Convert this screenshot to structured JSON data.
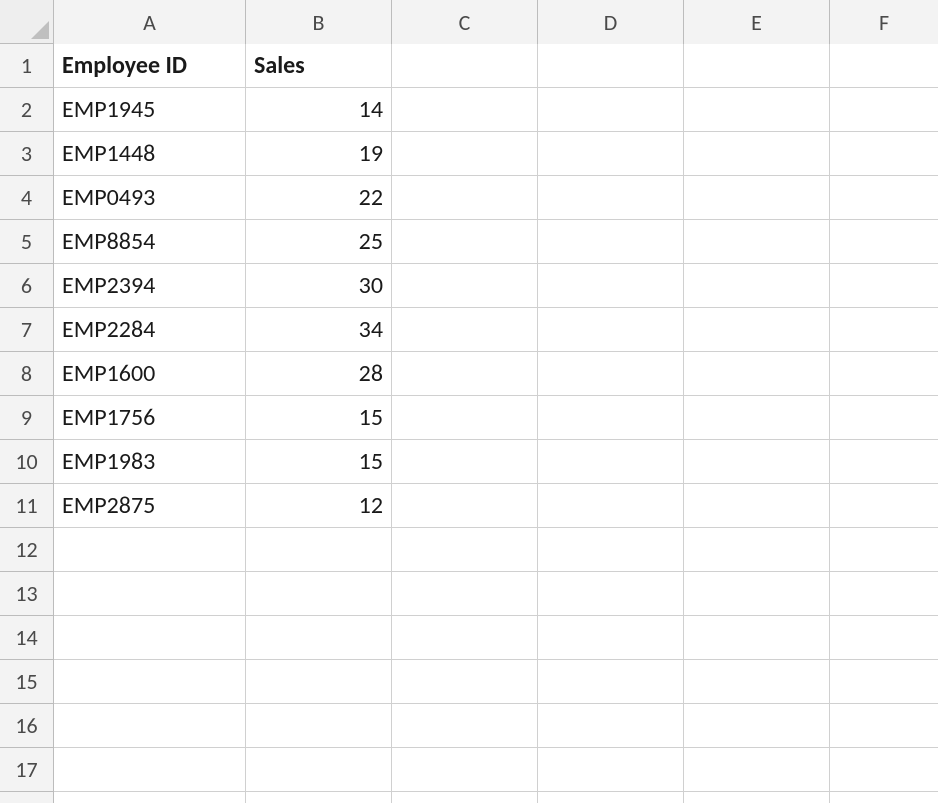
{
  "chart_data": {
    "type": "table",
    "columns": [
      "Employee ID",
      "Sales"
    ],
    "rows": [
      [
        "EMP1945",
        14
      ],
      [
        "EMP1448",
        19
      ],
      [
        "EMP0493",
        22
      ],
      [
        "EMP8854",
        25
      ],
      [
        "EMP2394",
        30
      ],
      [
        "EMP2284",
        34
      ],
      [
        "EMP1600",
        28
      ],
      [
        "EMP1756",
        15
      ],
      [
        "EMP1983",
        15
      ],
      [
        "EMP2875",
        12
      ]
    ]
  },
  "columns": {
    "labels": [
      "A",
      "B",
      "C",
      "D",
      "E",
      "F"
    ],
    "widths": [
      192,
      146,
      146,
      146,
      146,
      108
    ]
  },
  "rows": {
    "count": 18
  },
  "headers": {
    "A1": "Employee ID",
    "B1": "Sales"
  },
  "data": {
    "A2": "EMP1945",
    "B2": "14",
    "A3": "EMP1448",
    "B3": "19",
    "A4": "EMP0493",
    "B4": "22",
    "A5": "EMP8854",
    "B5": "25",
    "A6": "EMP2394",
    "B6": "30",
    "A7": "EMP2284",
    "B7": "34",
    "A8": "EMP1600",
    "B8": "28",
    "A9": "EMP1756",
    "B9": "15",
    "A10": "EMP1983",
    "B10": "15",
    "A11": "EMP2875",
    "B11": "12"
  }
}
